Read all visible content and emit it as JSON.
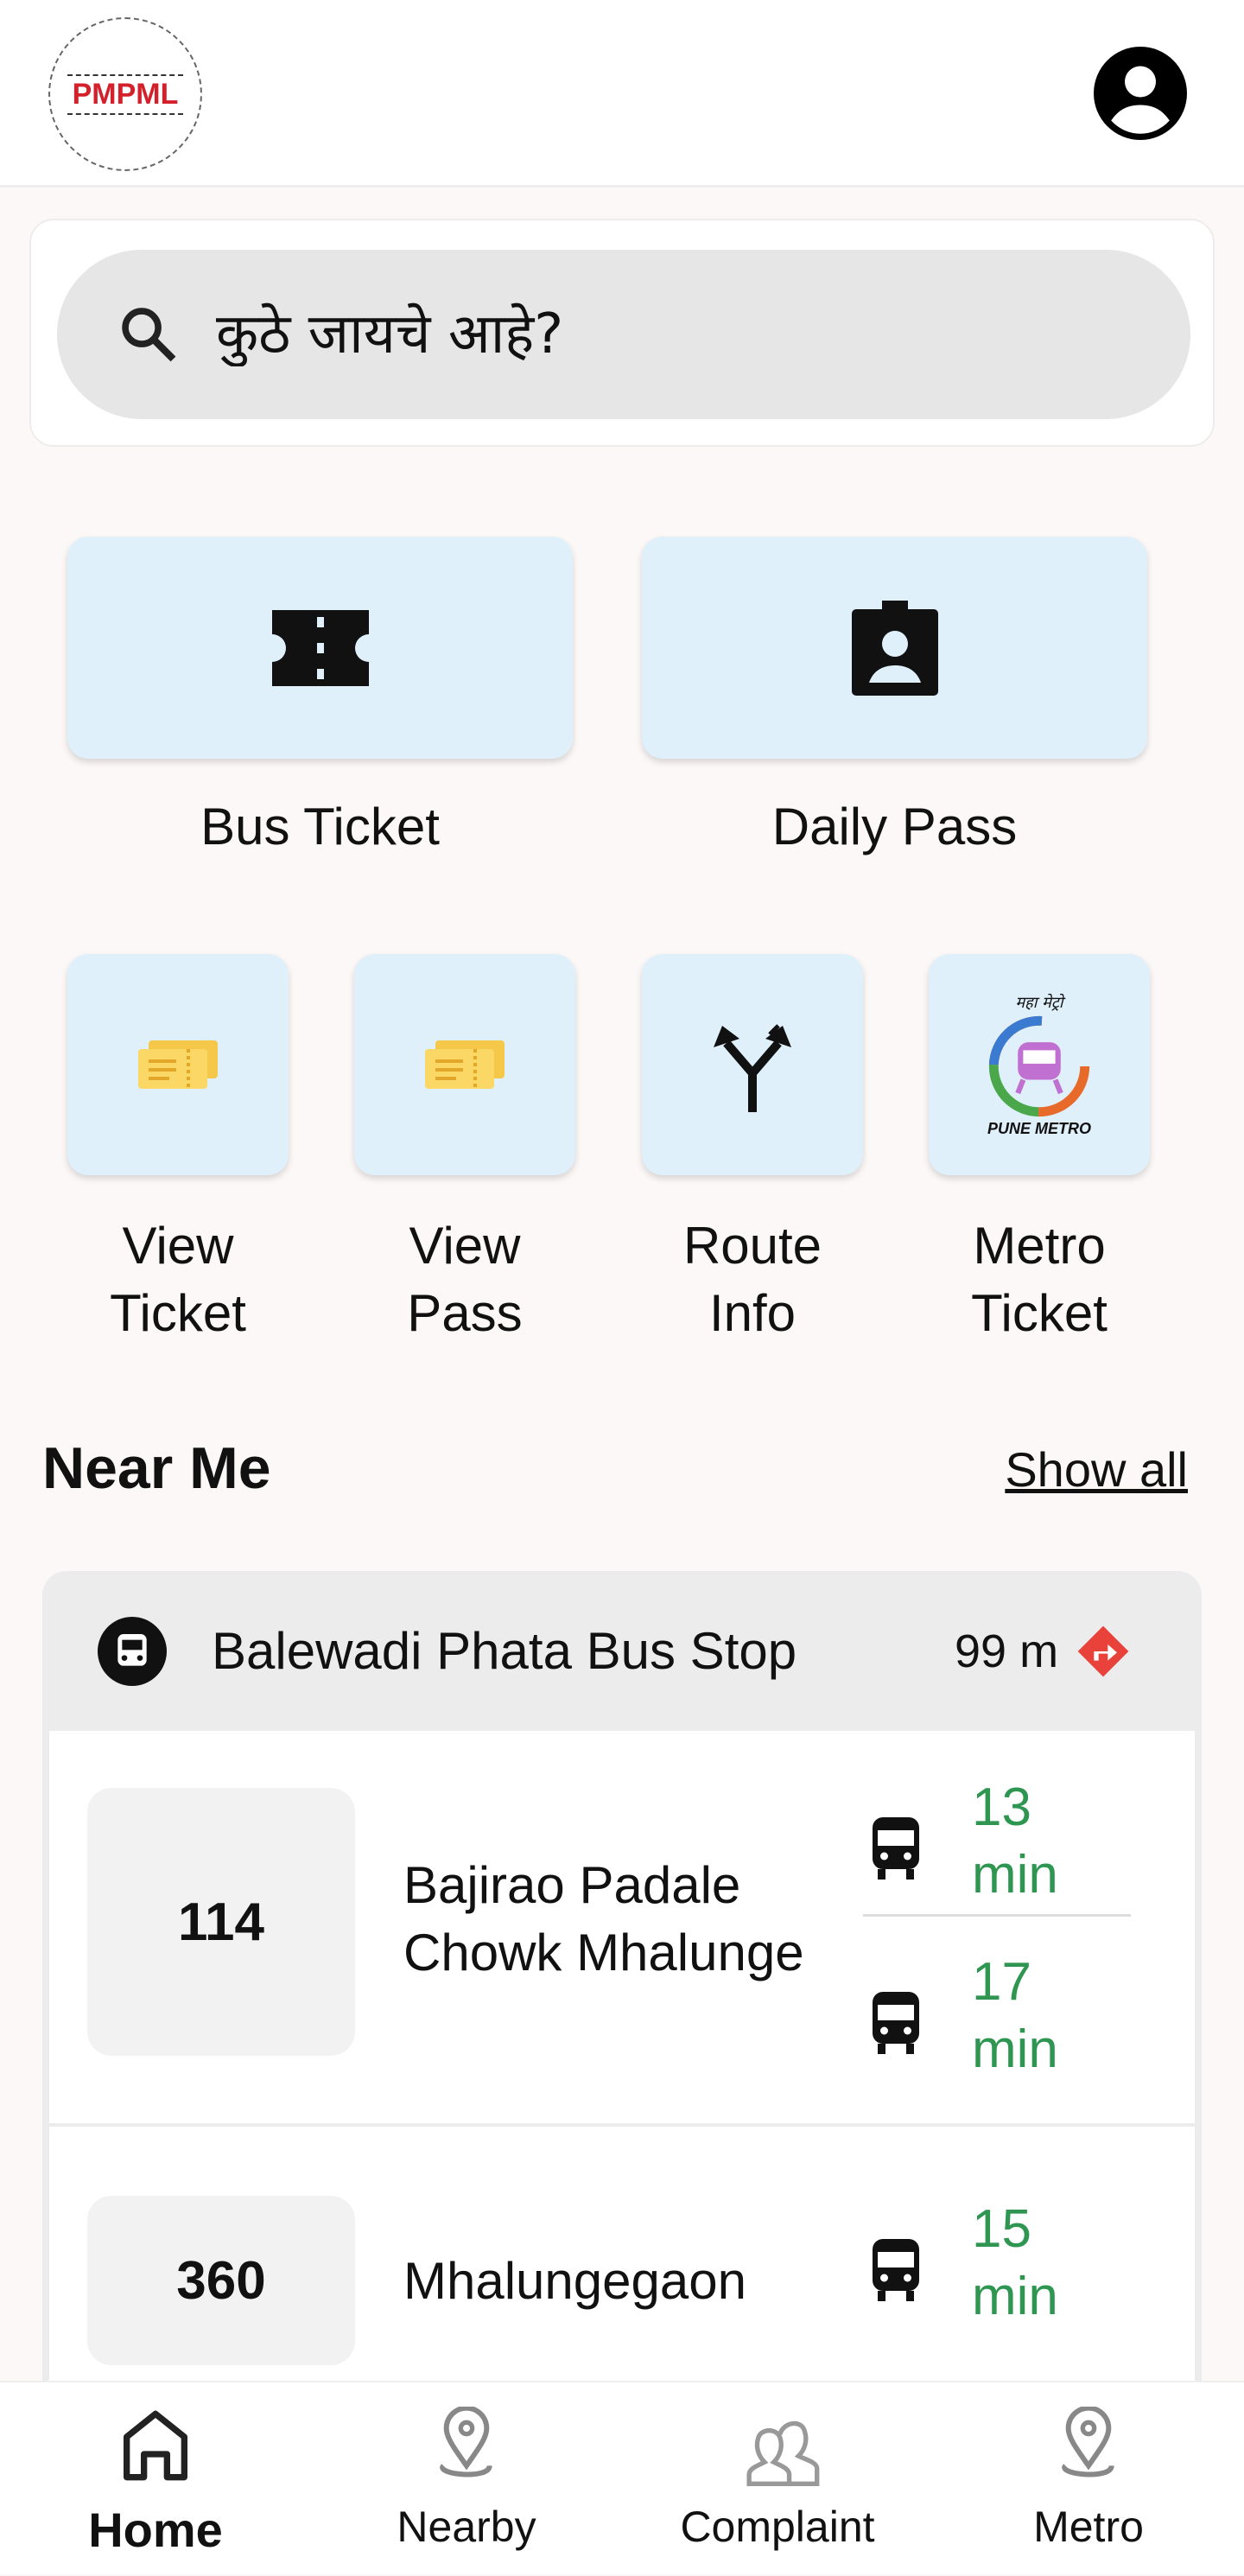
{
  "header": {
    "logo_text": "PMPML",
    "avatar_icon": "account-circle-icon"
  },
  "search": {
    "placeholder": "कुठे जायचे आहे?"
  },
  "main_actions": [
    {
      "label": "Bus Ticket",
      "icon": "ticket-icon"
    },
    {
      "label": "Daily Pass",
      "icon": "id-badge-icon"
    }
  ],
  "quick_actions": [
    {
      "line1": "View",
      "line2": "Ticket",
      "icon": "ticket-stub-icon"
    },
    {
      "line1": "View",
      "line2": "Pass",
      "icon": "ticket-stub-icon"
    },
    {
      "line1": "Route",
      "line2": "Info",
      "icon": "fork-arrows-icon"
    },
    {
      "line1": "Metro",
      "line2": "Ticket",
      "icon": "pune-metro-logo",
      "logo_top": "महा मेट्रो",
      "logo_bottom": "PUNE METRO"
    }
  ],
  "near_me": {
    "title": "Near Me",
    "show_all": "Show all",
    "stop": {
      "name": "Balewadi Phata Bus Stop",
      "distance": "99 m"
    },
    "routes": [
      {
        "number": "114",
        "dest1": "Bajirao Padale",
        "dest2": "Chowk Mhalunge",
        "etas": [
          {
            "value": "13",
            "unit": "min"
          },
          {
            "value": "17",
            "unit": "min"
          }
        ]
      },
      {
        "number": "360",
        "dest1": "Mhalungegaon",
        "etas": [
          {
            "value": "15",
            "unit": "min"
          }
        ]
      }
    ]
  },
  "colors": {
    "accent_green": "#2e9651",
    "tile_bg": "#dff0fb",
    "direction_red": "#e8423a"
  },
  "nav": [
    {
      "label": "Home",
      "active": true
    },
    {
      "label": "Nearby"
    },
    {
      "label": "Complaint"
    },
    {
      "label": "Metro"
    }
  ]
}
